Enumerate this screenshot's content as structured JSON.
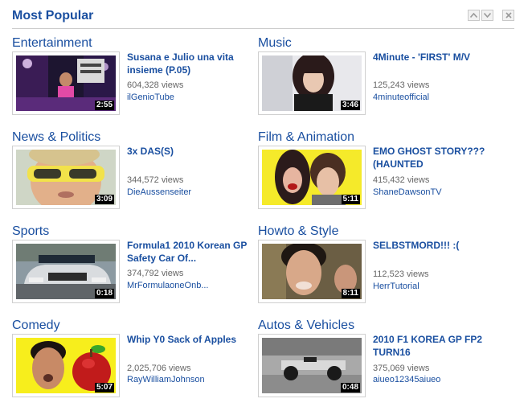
{
  "header": {
    "title": "Most Popular"
  },
  "categories": [
    {
      "name": "Entertainment",
      "video": {
        "title": "Susana e Julio una vita insieme (P.05)",
        "views": "604,328 views",
        "author": "ilGenioTube",
        "duration": "2:55"
      }
    },
    {
      "name": "Music",
      "video": {
        "title": "4Minute - 'FIRST' M/V",
        "views": "125,243 views",
        "author": "4minuteofficial",
        "duration": "3:46"
      }
    },
    {
      "name": "News & Politics",
      "video": {
        "title": "3x DAS(S)",
        "views": "344,572 views",
        "author": "DieAussenseiter",
        "duration": "3:09"
      }
    },
    {
      "name": "Film & Animation",
      "video": {
        "title": "EMO GHOST STORY??? (HAUNTED",
        "views": "415,432 views",
        "author": "ShaneDawsonTV",
        "duration": "5:11"
      }
    },
    {
      "name": "Sports",
      "video": {
        "title": "Formula1 2010 Korean GP Safety Car Of...",
        "views": "374,792 views",
        "author": "MrFormulaoneOnb...",
        "duration": "0:18"
      }
    },
    {
      "name": "Howto & Style",
      "video": {
        "title": "SELBSTMORD!!! :(",
        "views": "112,523 views",
        "author": "HerrTutorial",
        "duration": "8:11"
      }
    },
    {
      "name": "Comedy",
      "video": {
        "title": "Whip Y0 Sack of Apples",
        "views": "2,025,706 views",
        "author": "RayWilliamJohnson",
        "duration": "5:07"
      }
    },
    {
      "name": "Autos & Vehicles",
      "video": {
        "title": "2010 F1 KOREA GP FP2 TURN16",
        "views": "375,069 views",
        "author": "aiueo12345aiueo",
        "duration": "0:48"
      }
    }
  ]
}
